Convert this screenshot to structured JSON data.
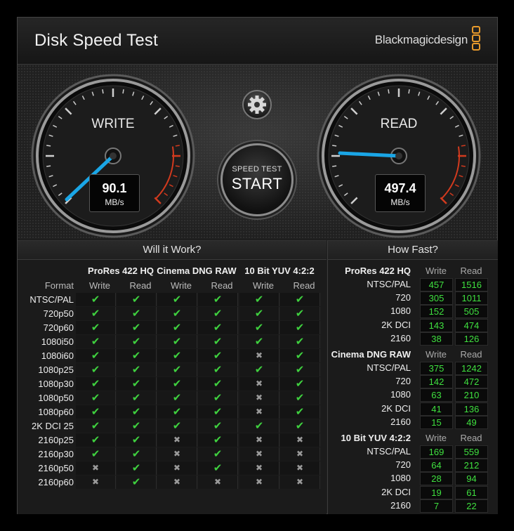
{
  "window": {
    "title": "Disk Speed Test",
    "brand": "Blackmagicdesign",
    "close_glyph": "×"
  },
  "gauges": {
    "write": {
      "label": "WRITE",
      "value": "90.1",
      "unit": "MB/s"
    },
    "read": {
      "label": "READ",
      "value": "497.4",
      "unit": "MB/s"
    }
  },
  "start_button": {
    "sub": "SPEED TEST",
    "main": "START"
  },
  "settings_icon": "gear-icon",
  "will_it_work": {
    "title": "Will it Work?",
    "format_header": "Format",
    "groups": [
      "ProRes 422 HQ",
      "Cinema DNG RAW",
      "10 Bit YUV 4:2:2"
    ],
    "subs": [
      "Write",
      "Read",
      "Write",
      "Read",
      "Write",
      "Read"
    ],
    "rows": [
      {
        "format": "NTSC/PAL",
        "cells": [
          1,
          1,
          1,
          1,
          1,
          1
        ]
      },
      {
        "format": "720p50",
        "cells": [
          1,
          1,
          1,
          1,
          1,
          1
        ]
      },
      {
        "format": "720p60",
        "cells": [
          1,
          1,
          1,
          1,
          1,
          1
        ]
      },
      {
        "format": "1080i50",
        "cells": [
          1,
          1,
          1,
          1,
          1,
          1
        ]
      },
      {
        "format": "1080i60",
        "cells": [
          1,
          1,
          1,
          1,
          0,
          1
        ]
      },
      {
        "format": "1080p25",
        "cells": [
          1,
          1,
          1,
          1,
          1,
          1
        ]
      },
      {
        "format": "1080p30",
        "cells": [
          1,
          1,
          1,
          1,
          0,
          1
        ]
      },
      {
        "format": "1080p50",
        "cells": [
          1,
          1,
          1,
          1,
          0,
          1
        ]
      },
      {
        "format": "1080p60",
        "cells": [
          1,
          1,
          1,
          1,
          0,
          1
        ]
      },
      {
        "format": "2K DCI 25",
        "cells": [
          1,
          1,
          1,
          1,
          1,
          1
        ]
      },
      {
        "format": "2160p25",
        "cells": [
          1,
          1,
          0,
          1,
          0,
          0
        ]
      },
      {
        "format": "2160p30",
        "cells": [
          1,
          1,
          0,
          1,
          0,
          0
        ]
      },
      {
        "format": "2160p50",
        "cells": [
          0,
          1,
          0,
          1,
          0,
          0
        ]
      },
      {
        "format": "2160p60",
        "cells": [
          0,
          1,
          0,
          0,
          0,
          0
        ]
      }
    ],
    "ok_glyph": "✔",
    "no_glyph": "✖"
  },
  "how_fast": {
    "title": "How Fast?",
    "sections": [
      {
        "name": "ProRes 422 HQ",
        "write_label": "Write",
        "read_label": "Read",
        "rows": [
          {
            "label": "NTSC/PAL",
            "write": "457",
            "read": "1516"
          },
          {
            "label": "720",
            "write": "305",
            "read": "1011"
          },
          {
            "label": "1080",
            "write": "152",
            "read": "505"
          },
          {
            "label": "2K DCI",
            "write": "143",
            "read": "474"
          },
          {
            "label": "2160",
            "write": "38",
            "read": "126"
          }
        ]
      },
      {
        "name": "Cinema DNG RAW",
        "write_label": "Write",
        "read_label": "Read",
        "rows": [
          {
            "label": "NTSC/PAL",
            "write": "375",
            "read": "1242"
          },
          {
            "label": "720",
            "write": "142",
            "read": "472"
          },
          {
            "label": "1080",
            "write": "63",
            "read": "210"
          },
          {
            "label": "2K DCI",
            "write": "41",
            "read": "136"
          },
          {
            "label": "2160",
            "write": "15",
            "read": "49"
          }
        ]
      },
      {
        "name": "10 Bit YUV 4:2:2",
        "write_label": "Write",
        "read_label": "Read",
        "rows": [
          {
            "label": "NTSC/PAL",
            "write": "169",
            "read": "559"
          },
          {
            "label": "720",
            "write": "64",
            "read": "212"
          },
          {
            "label": "1080",
            "write": "28",
            "read": "94"
          },
          {
            "label": "2K DCI",
            "write": "19",
            "read": "61"
          },
          {
            "label": "2160",
            "write": "7",
            "read": "22"
          }
        ]
      }
    ]
  },
  "colors": {
    "accent_needle": "#1aa6e6",
    "ok_green": "#3fd03f",
    "redline": "#d23a1e",
    "logo_orange": "#e89a2c"
  }
}
